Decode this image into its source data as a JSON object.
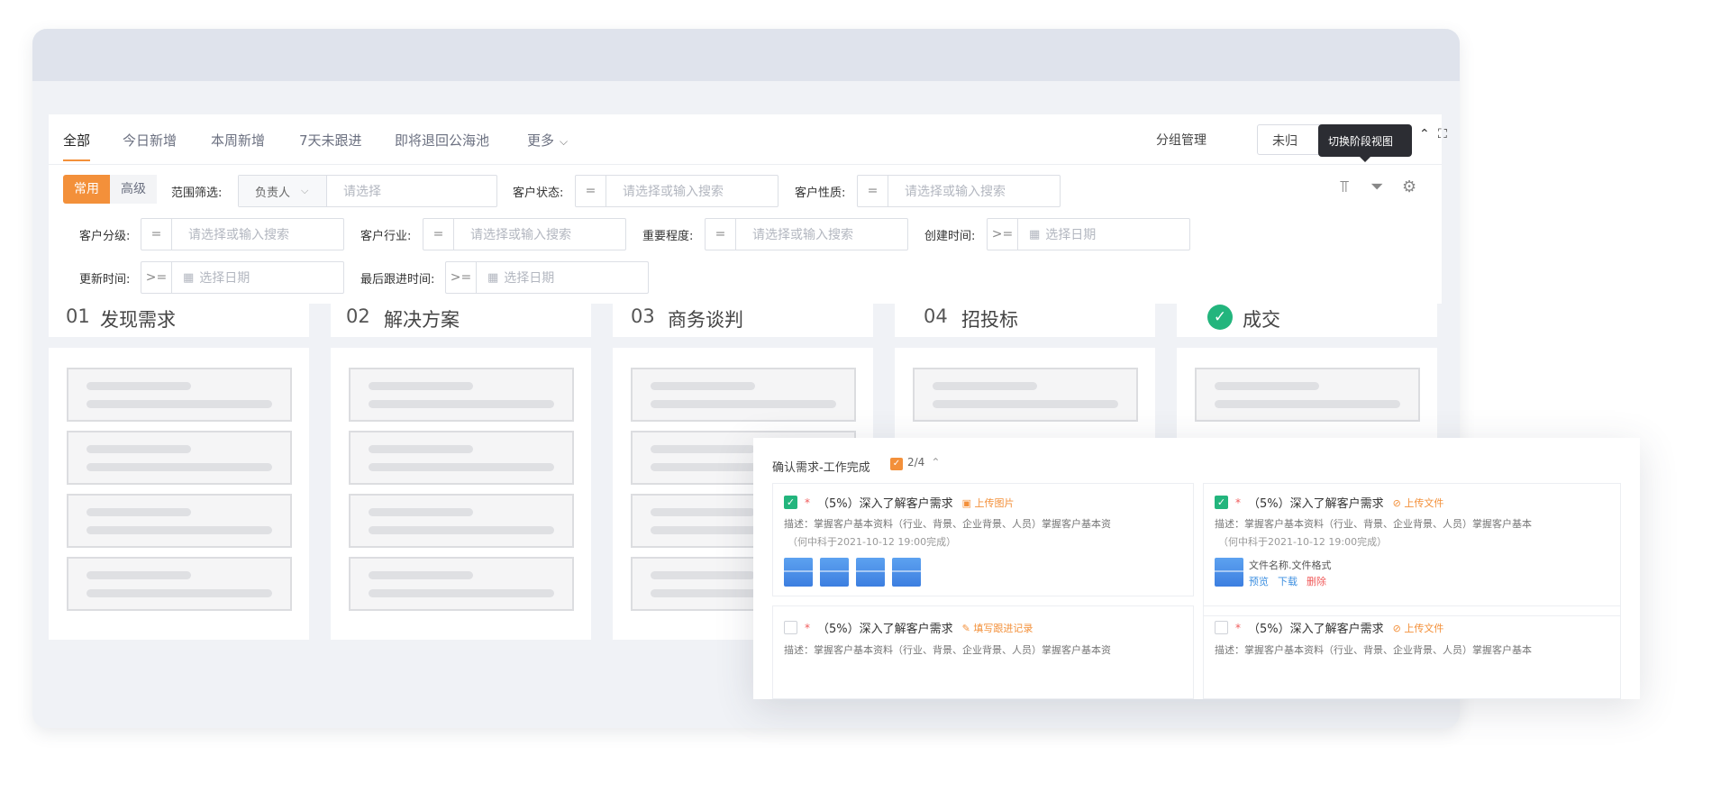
{
  "tabs": [
    "全部",
    "今日新增",
    "本周新增",
    "7天未跟进",
    "即将退回公海池",
    "更多"
  ],
  "header": {
    "group_manage": "分组管理",
    "unassigned": "未归",
    "tooltip": "切换阶段视图"
  },
  "filter": {
    "mode_common": "常用",
    "mode_advanced": "高级",
    "range_label": "范围筛选:",
    "owner": "负责人",
    "select_placeholder": "请选择",
    "status_label": "客户状态:",
    "nature_label": "客户性质:",
    "level_label": "客户分级:",
    "industry_label": "客户行业:",
    "importance_label": "重要程度:",
    "created_label": "创建时间:",
    "updated_label": "更新时间:",
    "last_follow_label": "最后跟进时间:",
    "search_placeholder": "请选择或输入搜索",
    "date_placeholder": "选择日期",
    "op_eq": "=",
    "op_gte": ">="
  },
  "stages": [
    {
      "num": "01",
      "name": "发现需求"
    },
    {
      "num": "02",
      "name": "解决方案"
    },
    {
      "num": "03",
      "name": "商务谈判"
    },
    {
      "num": "04",
      "name": "招投标"
    },
    {
      "num": "",
      "name": "成交"
    }
  ],
  "card": {
    "title": "确认需求-工作完成",
    "count": "2/4",
    "tasks": [
      {
        "title": "（5%）深入了解客户需求",
        "link": "上传图片",
        "desc": "描述：掌握客户基本资料（行业、背景、企业背景、人员）掌握客户基本资",
        "due": "（何中科于2021-10-12 19:00完成）"
      },
      {
        "title": "（5%）深入了解客户需求",
        "link": "上传文件",
        "desc": "描述：掌握客户基本资料（行业、背景、企业背景、人员）掌握客户基本",
        "due": "（何中科于2021-10-12 19:00完成）",
        "file_name": "文件名称.文件格式",
        "actions": [
          "预览",
          "下载",
          "删除"
        ]
      },
      {
        "title": "（5%）深入了解客户需求",
        "link": "填写跟进记录",
        "desc": "描述：掌握客户基本资料（行业、背景、企业背景、人员）掌握客户基本资"
      },
      {
        "title": "（5%）深入了解客户需求",
        "link": "上传文件",
        "desc": "描述：掌握客户基本资料（行业、背景、企业背景、人员）掌握客户基本"
      }
    ]
  },
  "colors": {
    "accent": "#f3903a",
    "success": "#23b57d",
    "link": "#3d8fe0",
    "danger": "#f05b5b"
  }
}
